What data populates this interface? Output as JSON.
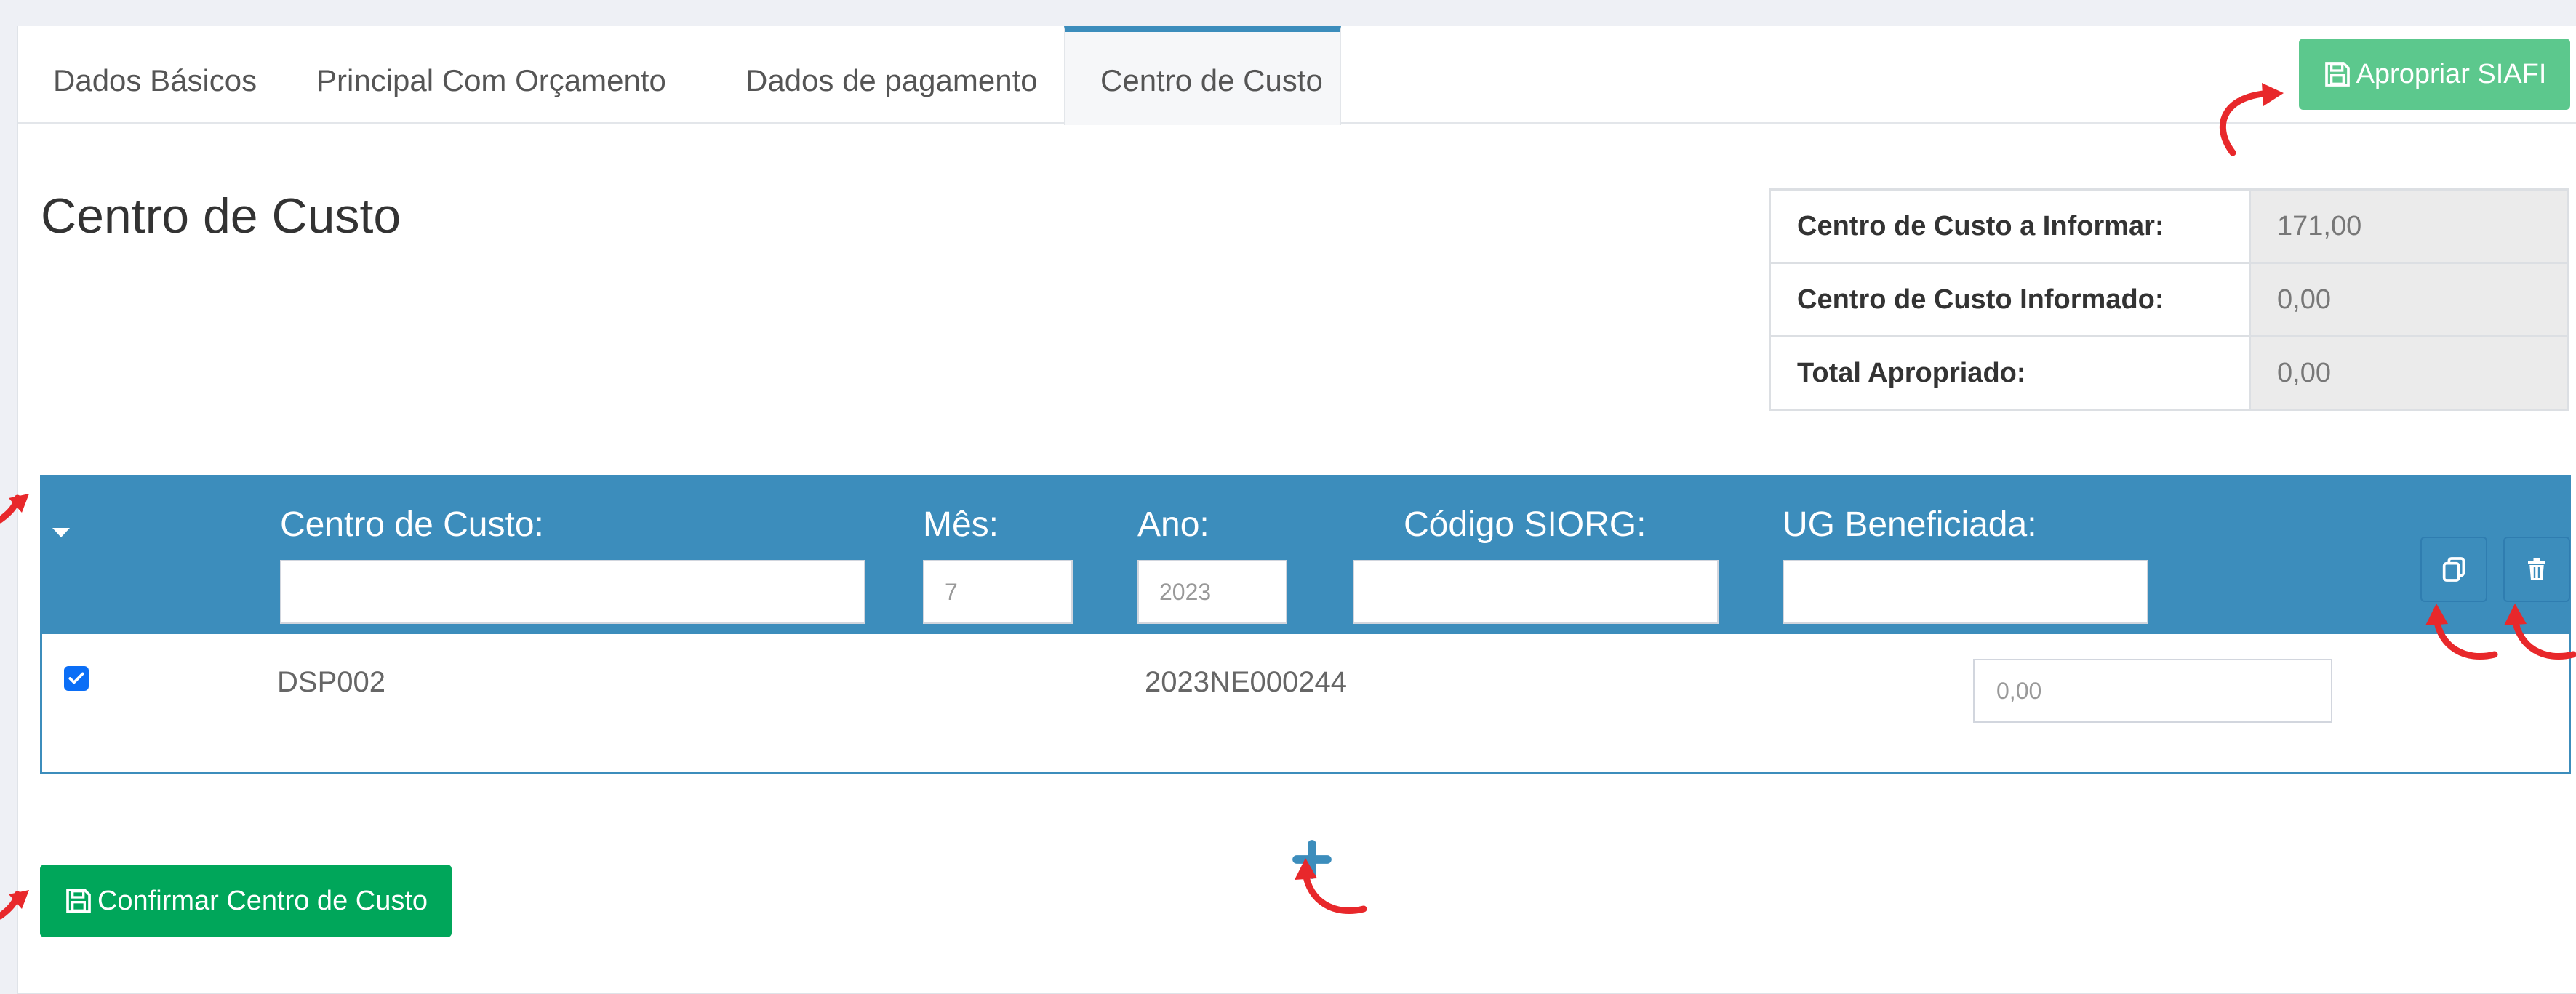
{
  "tabs": [
    {
      "label": "Dados Básicos"
    },
    {
      "label": "Principal Com Orçamento"
    },
    {
      "label": "Dados de pagamento"
    },
    {
      "label": "Centro de Custo",
      "active": true
    }
  ],
  "actions": {
    "apropriar_label": "Apropriar SIAFI",
    "confirmar_label": "Confirmar Centro de Custo"
  },
  "page_title": "Centro de Custo",
  "summary": [
    {
      "label": "Centro de Custo a Informar:",
      "value": "171,00"
    },
    {
      "label": "Centro de Custo Informado:",
      "value": "0,00"
    },
    {
      "label": "Total Apropriado:",
      "value": "0,00"
    }
  ],
  "cost_center": {
    "fields": {
      "centro_label": "Centro de Custo:",
      "centro_value": "",
      "mes_label": "Mês:",
      "mes_value": "7",
      "ano_label": "Ano:",
      "ano_value": "2023",
      "siorg_label": "Código SIORG:",
      "siorg_value": "",
      "ug_label": "UG Beneficiada:",
      "ug_value": ""
    },
    "row": {
      "checked": true,
      "code": "DSP002",
      "empenho": "2023NE000244",
      "value_placeholder": "0,00"
    }
  },
  "colors": {
    "primary": "#3c8dbc",
    "success": "#00a65a",
    "success_light": "#5cc88d",
    "annotation": "#e8282b"
  },
  "icons": [
    "save-icon",
    "copy-icon",
    "trash-icon",
    "caret-down-icon",
    "plus-icon",
    "check-icon",
    "annotation-arrow"
  ]
}
